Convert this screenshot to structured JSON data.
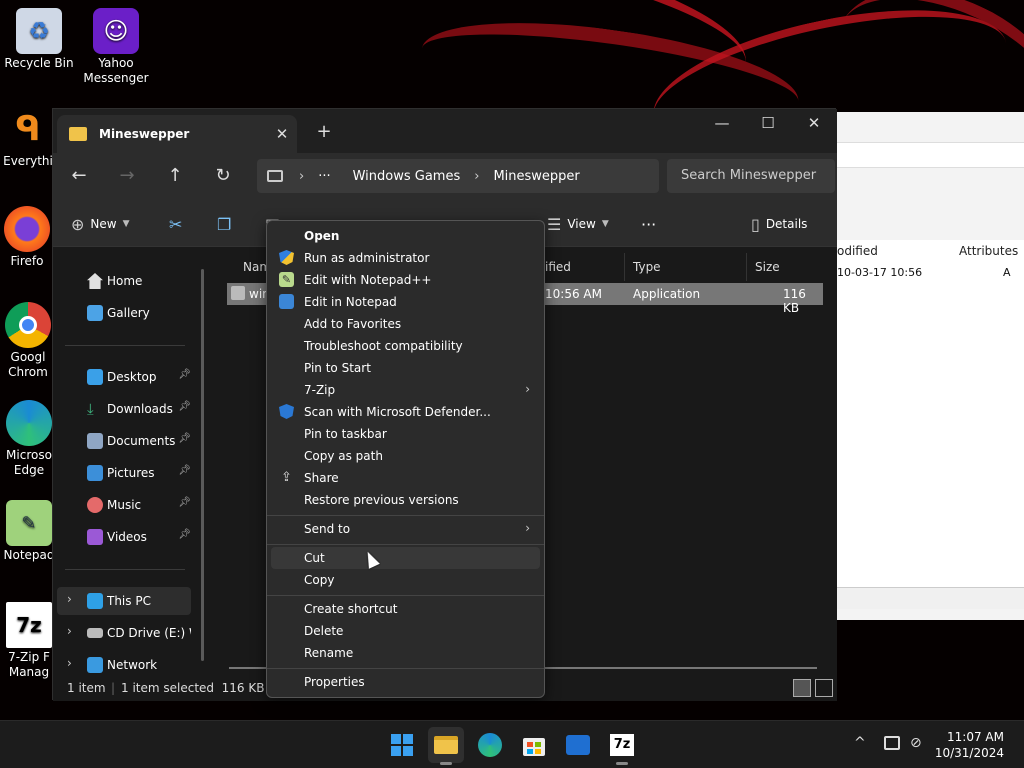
{
  "desktop": {
    "icons": [
      {
        "label": "Recycle Bin"
      },
      {
        "label": "Yahoo Messenger"
      },
      {
        "label": "Everythi"
      },
      {
        "label": "Firefo"
      },
      {
        "label": "Googl Chrom"
      },
      {
        "label": "Microso Edge"
      },
      {
        "label": "Notepad"
      },
      {
        "label": "7-Zip F Manag"
      }
    ]
  },
  "explorer": {
    "tab_title": "Mineswepper",
    "tab_close_glyph": "✕",
    "new_tab_glyph": "+",
    "window_controls": {
      "minimize": "—",
      "maximize": "☐",
      "close": "✕"
    },
    "address": {
      "more": "···",
      "crumbs": [
        "Windows Games",
        "Mineswepper"
      ],
      "separator": "›"
    },
    "search_placeholder": "Search Mineswepper",
    "toolbar": {
      "new_label": "New",
      "view_label": "View",
      "more_glyph": "···",
      "details_label": "Details"
    },
    "sidebar": {
      "items": [
        {
          "label": "Home"
        },
        {
          "label": "Gallery"
        },
        {
          "label": "Desktop"
        },
        {
          "label": "Downloads"
        },
        {
          "label": "Documents"
        },
        {
          "label": "Pictures"
        },
        {
          "label": "Music"
        },
        {
          "label": "Videos"
        },
        {
          "label": "This PC"
        },
        {
          "label": "CD Drive (E:) WI"
        },
        {
          "label": "Network"
        }
      ]
    },
    "columns": [
      "Nam",
      "ified",
      "Type",
      "Size"
    ],
    "file": {
      "name": "win",
      "modified": "10:56 AM",
      "type": "Application",
      "size": "116 KB"
    },
    "status": {
      "items": "1 item",
      "selected": "1 item selected  116 KB"
    }
  },
  "background_window": {
    "columns": [
      "odified",
      "Attributes"
    ],
    "row": {
      "modified": "10-03-17 10:56",
      "attr": "A"
    }
  },
  "context_menu": {
    "items": [
      {
        "label": "Open"
      },
      {
        "label": "Run as administrator"
      },
      {
        "label": "Edit with Notepad++"
      },
      {
        "label": "Edit in Notepad"
      },
      {
        "label": "Add to Favorites"
      },
      {
        "label": "Troubleshoot compatibility"
      },
      {
        "label": "Pin to Start"
      },
      {
        "label": "7-Zip"
      },
      {
        "label": "Scan with Microsoft Defender..."
      },
      {
        "label": "Pin to taskbar"
      },
      {
        "label": "Copy as path"
      },
      {
        "label": "Share"
      },
      {
        "label": "Restore previous versions"
      },
      {
        "label": "Send to"
      },
      {
        "label": "Cut"
      },
      {
        "label": "Copy"
      },
      {
        "label": "Create shortcut"
      },
      {
        "label": "Delete"
      },
      {
        "label": "Rename"
      },
      {
        "label": "Properties"
      }
    ],
    "submenu_arrow": "›"
  },
  "taskbar": {
    "clock_time": "11:07 AM",
    "clock_date": "10/31/2024",
    "tray_chevron": "^",
    "zip_label": "7z"
  },
  "colors": {
    "accent": "#0078d4",
    "folder": "#f0c34a",
    "menu_bg": "#2b2b2b"
  }
}
